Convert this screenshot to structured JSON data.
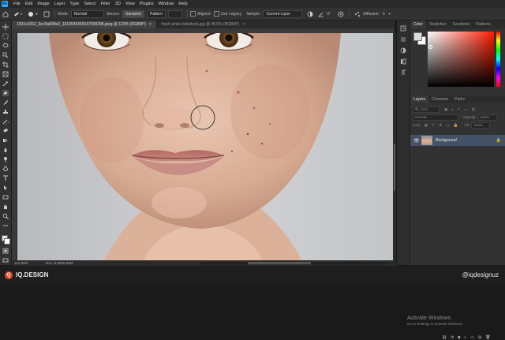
{
  "app": {
    "logo": "Ps"
  },
  "menu": [
    "File",
    "Edit",
    "Image",
    "Layer",
    "Type",
    "Select",
    "Filter",
    "3D",
    "View",
    "Plugins",
    "Window",
    "Help"
  ],
  "options": {
    "mode_label": "Mode:",
    "mode_value": "Normal",
    "source_label": "Source:",
    "source_sampled": "Sampled",
    "source_pattern": "Pattern",
    "aligned_label": "Aligned",
    "use_legacy_label": "Use Legacy",
    "sample_label": "Sample:",
    "sample_value": "Current Layer",
    "angle_value": "0°",
    "diffusion_label": "Diffusion:",
    "diffusion_value": "5"
  },
  "tabs": [
    {
      "label": "1931x1552_0ec0a838e2_1619044359147609296.jpeg @ 123% (RGB/8*)",
      "close": "×"
    },
    {
      "label": "fresh-white-babebela.jpg @ 48.5% (RGB/8*)",
      "close": "×"
    }
  ],
  "status": {
    "zoom": "122.98%",
    "doc": "Doc: 8.9M/8.89M"
  },
  "panels": {
    "color_tabs": [
      "Color",
      "Swatches",
      "Gradients",
      "Patterns"
    ],
    "layers_tabs": [
      "Layers",
      "Channels",
      "Paths"
    ],
    "kind_label": "Kind",
    "blend_mode": "Normal",
    "opacity_label": "Opacity:",
    "opacity_value": "100%",
    "lock_label": "Lock:",
    "fill_label": "Fill:",
    "fill_value": "100%",
    "layer_name": "Background",
    "activate_title": "Activate Windows",
    "activate_sub": "Go to Settings to activate Windows."
  },
  "brand": {
    "name": "IQ.DESIGN",
    "handle": "@iqdesignuz"
  },
  "colors": {
    "accent": "#31a8ff",
    "selected_layer": "#435267",
    "brand": "#e04a2a"
  }
}
